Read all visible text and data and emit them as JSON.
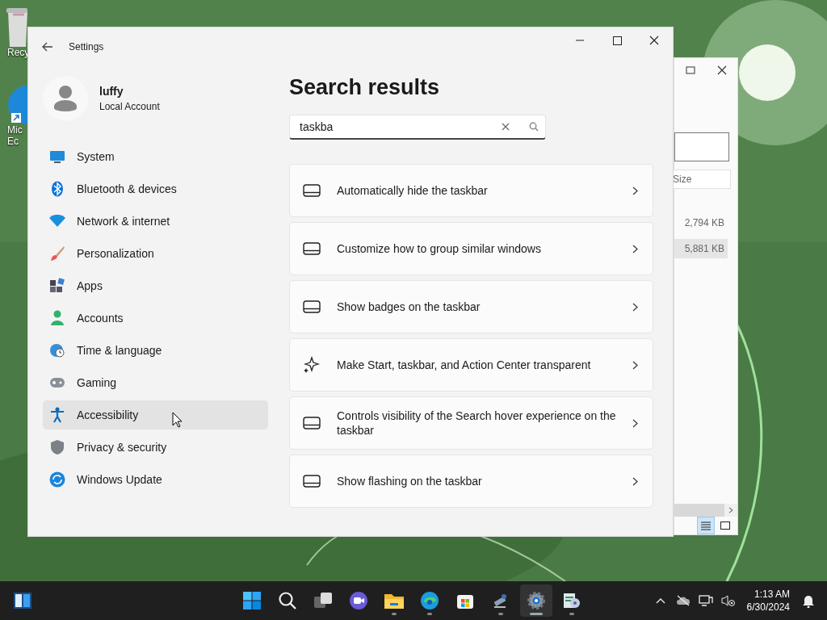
{
  "desktop_icons": [
    {
      "lines": [
        "Recy"
      ]
    },
    {
      "lines": [
        "Mic",
        "Ec"
      ]
    }
  ],
  "background_window": {
    "column_header": "Size",
    "rows": [
      {
        "size": "2,794 KB",
        "selected": false
      },
      {
        "size": "5,881 KB",
        "selected": true
      }
    ],
    "views": [
      {
        "selected": true
      },
      {
        "selected": false
      }
    ]
  },
  "settings": {
    "title": "Settings",
    "user": {
      "name": "luffy",
      "account": "Local Account"
    },
    "nav": [
      {
        "label": "System",
        "highlighted": false
      },
      {
        "label": "Bluetooth & devices",
        "highlighted": false
      },
      {
        "label": "Network & internet",
        "highlighted": false
      },
      {
        "label": "Personalization",
        "highlighted": false
      },
      {
        "label": "Apps",
        "highlighted": false
      },
      {
        "label": "Accounts",
        "highlighted": false
      },
      {
        "label": "Time & language",
        "highlighted": false
      },
      {
        "label": "Gaming",
        "highlighted": false
      },
      {
        "label": "Accessibility",
        "highlighted": true
      },
      {
        "label": "Privacy & security",
        "highlighted": false
      },
      {
        "label": "Windows Update",
        "highlighted": false
      }
    ],
    "heading": "Search results",
    "search": {
      "value": "taskba"
    },
    "results": [
      {
        "kind": "taskbar",
        "label": "Automatically hide the taskbar"
      },
      {
        "kind": "taskbar",
        "label": "Customize how to group similar windows"
      },
      {
        "kind": "taskbar",
        "label": "Show badges on the taskbar"
      },
      {
        "kind": "effects",
        "label": "Make Start, taskbar, and Action Center transparent"
      },
      {
        "kind": "taskbar",
        "label": "Controls visibility of the Search hover experience on the taskbar"
      },
      {
        "kind": "taskbar",
        "label": "Show flashing on the taskbar"
      }
    ]
  },
  "taskbar": {
    "pinned": [
      {
        "running": false,
        "active": false
      },
      {
        "running": false,
        "active": false
      },
      {
        "running": false,
        "active": false
      },
      {
        "running": false,
        "active": false
      },
      {
        "running": true,
        "active": false
      },
      {
        "running": true,
        "active": false
      },
      {
        "running": false,
        "active": false
      },
      {
        "running": true,
        "active": false
      },
      {
        "running": true,
        "active": true
      },
      {
        "running": true,
        "active": false
      }
    ],
    "clock": {
      "time": "1:13 AM",
      "date": "6/30/2024"
    }
  }
}
